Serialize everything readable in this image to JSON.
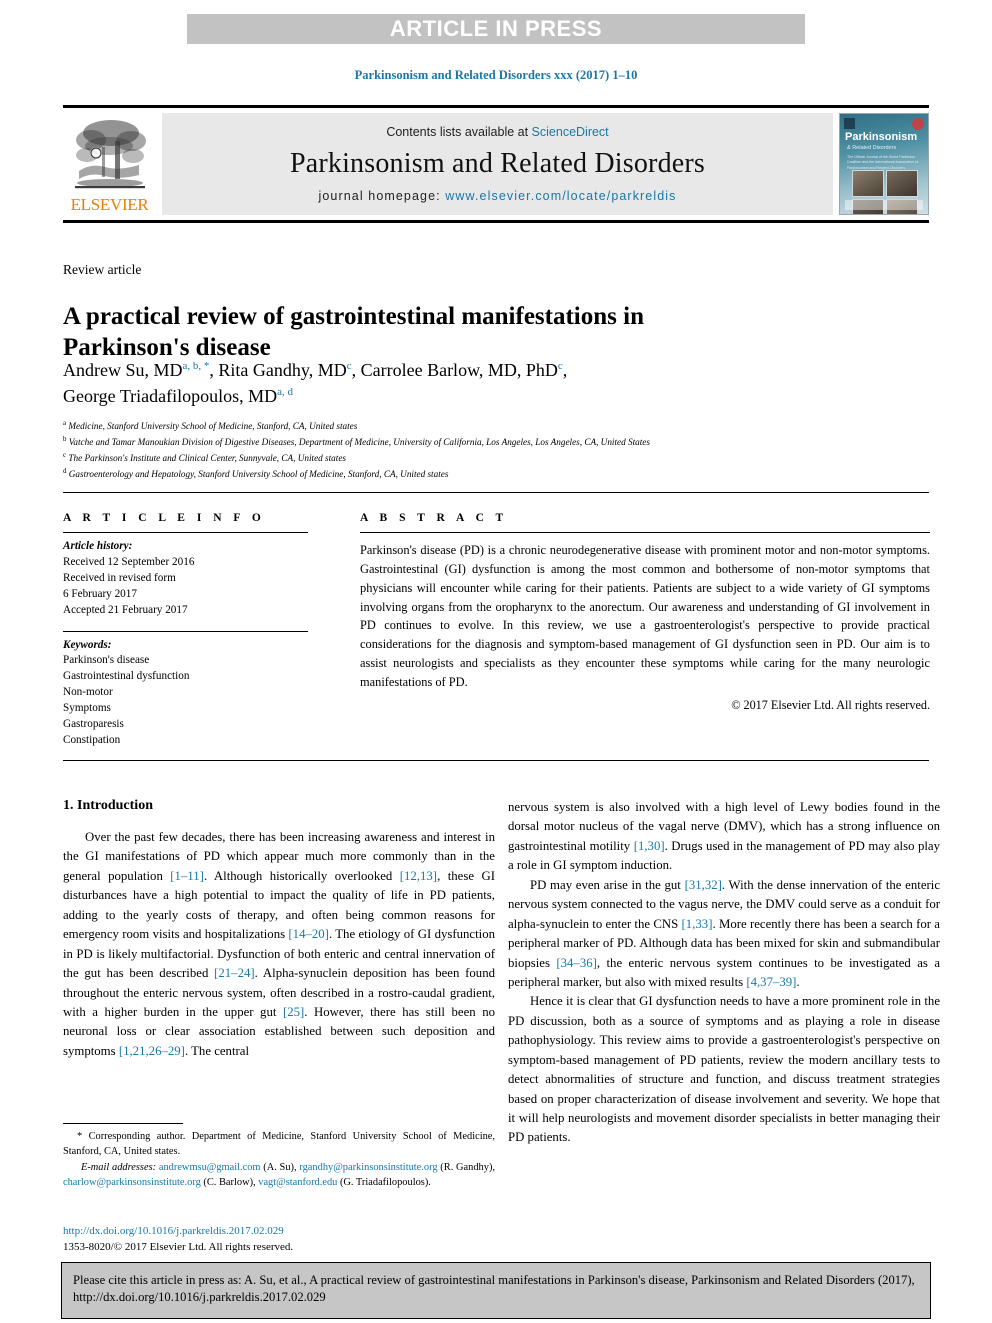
{
  "banner": {
    "text": "ARTICLE IN PRESS"
  },
  "running_head": "Parkinsonism and Related Disorders xxx (2017) 1–10",
  "masthead": {
    "publisher_name": "ELSEVIER",
    "contents_prefix": "Contents lists available at ",
    "contents_link": "ScienceDirect",
    "journal_title": "Parkinsonism and Related Disorders",
    "homepage_prefix": "journal homepage: ",
    "homepage_url": "www.elsevier.com/locate/parkreldis",
    "cover": {
      "title": "Parkinsonism",
      "subtitle": "& Related Disorders",
      "blurb": "The Official Journal of the World Parkinson Coalition and the International Association of Parkinsonism and Related Disorders"
    }
  },
  "article": {
    "type_label": "Review article",
    "title": "A practical review of gastrointestinal manifestations in Parkinson's disease",
    "authors_line_1": "Andrew Su, MD",
    "authors_sup_1": "a, b, *",
    "authors_line_1b": ", Rita Gandhy, MD",
    "authors_sup_1b": "c",
    "authors_line_1c": ", Carrolee Barlow, MD, PhD",
    "authors_sup_1c": "c",
    "authors_line_1d": ",",
    "authors_line_2": "George Triadafilopoulos, MD",
    "authors_sup_2": "a, d",
    "affiliations": [
      {
        "marker": "a",
        "text": "Medicine, Stanford University School of Medicine, Stanford, CA, United states"
      },
      {
        "marker": "b",
        "text": "Vatche and Tamar Manoukian Division of Digestive Diseases, Department of Medicine, University of California, Los Angeles, Los Angeles, CA, United States"
      },
      {
        "marker": "c",
        "text": "The Parkinson's Institute and Clinical Center, Sunnyvale, CA, United states"
      },
      {
        "marker": "d",
        "text": "Gastroenterology and Hepatology, Stanford University School of Medicine, Stanford, CA, United states"
      }
    ]
  },
  "article_info": {
    "heading": "A R T I C L E   I N F O",
    "history_label": "Article history:",
    "history_lines": [
      "Received 12 September 2016",
      "Received in revised form",
      "6 February 2017",
      "Accepted 21 February 2017"
    ],
    "keywords_label": "Keywords:",
    "keywords": [
      "Parkinson's disease",
      "Gastrointestinal dysfunction",
      "Non-motor",
      "Symptoms",
      "Gastroparesis",
      "Constipation"
    ]
  },
  "abstract": {
    "heading": "A B S T R A C T",
    "body": "Parkinson's disease (PD) is a chronic neurodegenerative disease with prominent motor and non-motor symptoms. Gastrointestinal (GI) dysfunction is among the most common and bothersome of non-motor symptoms that physicians will encounter while caring for their patients. Patients are subject to a wide variety of GI symptoms involving organs from the oropharynx to the anorectum. Our awareness and understanding of GI involvement in PD continues to evolve. In this review, we use a gastroenterologist's perspective to provide practical considerations for the diagnosis and symptom-based management of GI dysfunction seen in PD. Our aim is to assist neurologists and specialists as they encounter these symptoms while caring for the many neurologic manifestations of PD.",
    "copyright": "© 2017 Elsevier Ltd. All rights reserved."
  },
  "body": {
    "section_heading": "1. Introduction",
    "left_para_1_a": "Over the past few decades, there has been increasing awareness and interest in the GI manifestations of PD which appear much more commonly than in the general population ",
    "left_ref_1": "[1–11]",
    "left_para_1_b": ". Although historically overlooked ",
    "left_ref_2": "[12,13]",
    "left_para_1_c": ", these GI disturbances have a high potential to impact the quality of life in PD patients, adding to the yearly costs of therapy, and often being common reasons for emergency room visits and hospitalizations ",
    "left_ref_3": "[14–20]",
    "left_para_1_d": ". The etiology of GI dysfunction in PD is likely multifactorial. Dysfunction of both enteric and central innervation of the gut has been described ",
    "left_ref_4": "[21–24]",
    "left_para_1_e": ". Alpha-synuclein deposition has been found throughout the enteric nervous system, often described in a rostro-caudal gradient, with a higher burden in the upper gut ",
    "left_ref_5": "[25]",
    "left_para_1_f": ". However, there has still been no neuronal loss or clear association established between such deposition and symptoms ",
    "left_ref_6": "[1,21,26–29]",
    "left_para_1_g": ". The central",
    "right_para_1_a": "nervous system is also involved with a high level of Lewy bodies found in the dorsal motor nucleus of the vagal nerve (DMV), which has a strong influence on gastrointestinal motility ",
    "right_ref_1": "[1,30]",
    "right_para_1_b": ". Drugs used in the management of PD may also play a role in GI symptom induction.",
    "right_para_2_a": "PD may even arise in the gut ",
    "right_ref_2": "[31,32]",
    "right_para_2_b": ". With the dense innervation of the enteric nervous system connected to the vagus nerve, the DMV could serve as a conduit for alpha-synuclein to enter the CNS ",
    "right_ref_3": "[1,33]",
    "right_para_2_c": ". More recently there has been a search for a peripheral marker of PD. Although data has been mixed for skin and submandibular biopsies ",
    "right_ref_4": "[34–36]",
    "right_para_2_d": ", the enteric nervous system continues to be investigated as a peripheral marker, but also with mixed results ",
    "right_ref_5": "[4,37–39]",
    "right_para_2_e": ".",
    "right_para_3": "Hence it is clear that GI dysfunction needs to have a more prominent role in the PD discussion, both as a source of symptoms and as playing a role in disease pathophysiology. This review aims to provide a gastroenterologist's perspective on symptom-based management of PD patients, review the modern ancillary tests to detect abnormalities of structure and function, and discuss treatment strategies based on proper characterization of disease involvement and severity. We hope that it will help neurologists and movement disorder specialists in better managing their PD patients."
  },
  "footnotes": {
    "corresponding_marker": "*",
    "corresponding_text": " Corresponding author. Department of Medicine, Stanford University School of Medicine, Stanford, CA, United states.",
    "email_label": "E-mail addresses:",
    "email_1": "andrewmsu@gmail.com",
    "email_1_owner": " (A. Su), ",
    "email_2": "rgandhy@parkinsonsinstitute.org",
    "email_2_owner": " (R. Gandhy), ",
    "email_3": "charlow@parkinsonsinstitute.org",
    "email_3_owner": " (C. Barlow), ",
    "email_4": "vagt@stanford.edu",
    "email_4_owner": " (G. Triadafilopoulos)."
  },
  "doi_block": {
    "doi_url": "http://dx.doi.org/10.1016/j.parkreldis.2017.02.029",
    "issn_line": "1353-8020/© 2017 Elsevier Ltd. All rights reserved."
  },
  "citation_footer": {
    "text": "Please cite this article in press as: A. Su, et al., A practical review of gastrointestinal manifestations in Parkinson's disease, Parkinsonism and Related Disorders (2017), http://dx.doi.org/10.1016/j.parkreldis.2017.02.029"
  },
  "colors": {
    "accent": "#1878a8",
    "elsevier_orange": "#ef7d00",
    "banner_gray": "#c2c2c2",
    "masthead_gray": "#e8e8e8",
    "footer_gray": "#c6c6c6"
  }
}
